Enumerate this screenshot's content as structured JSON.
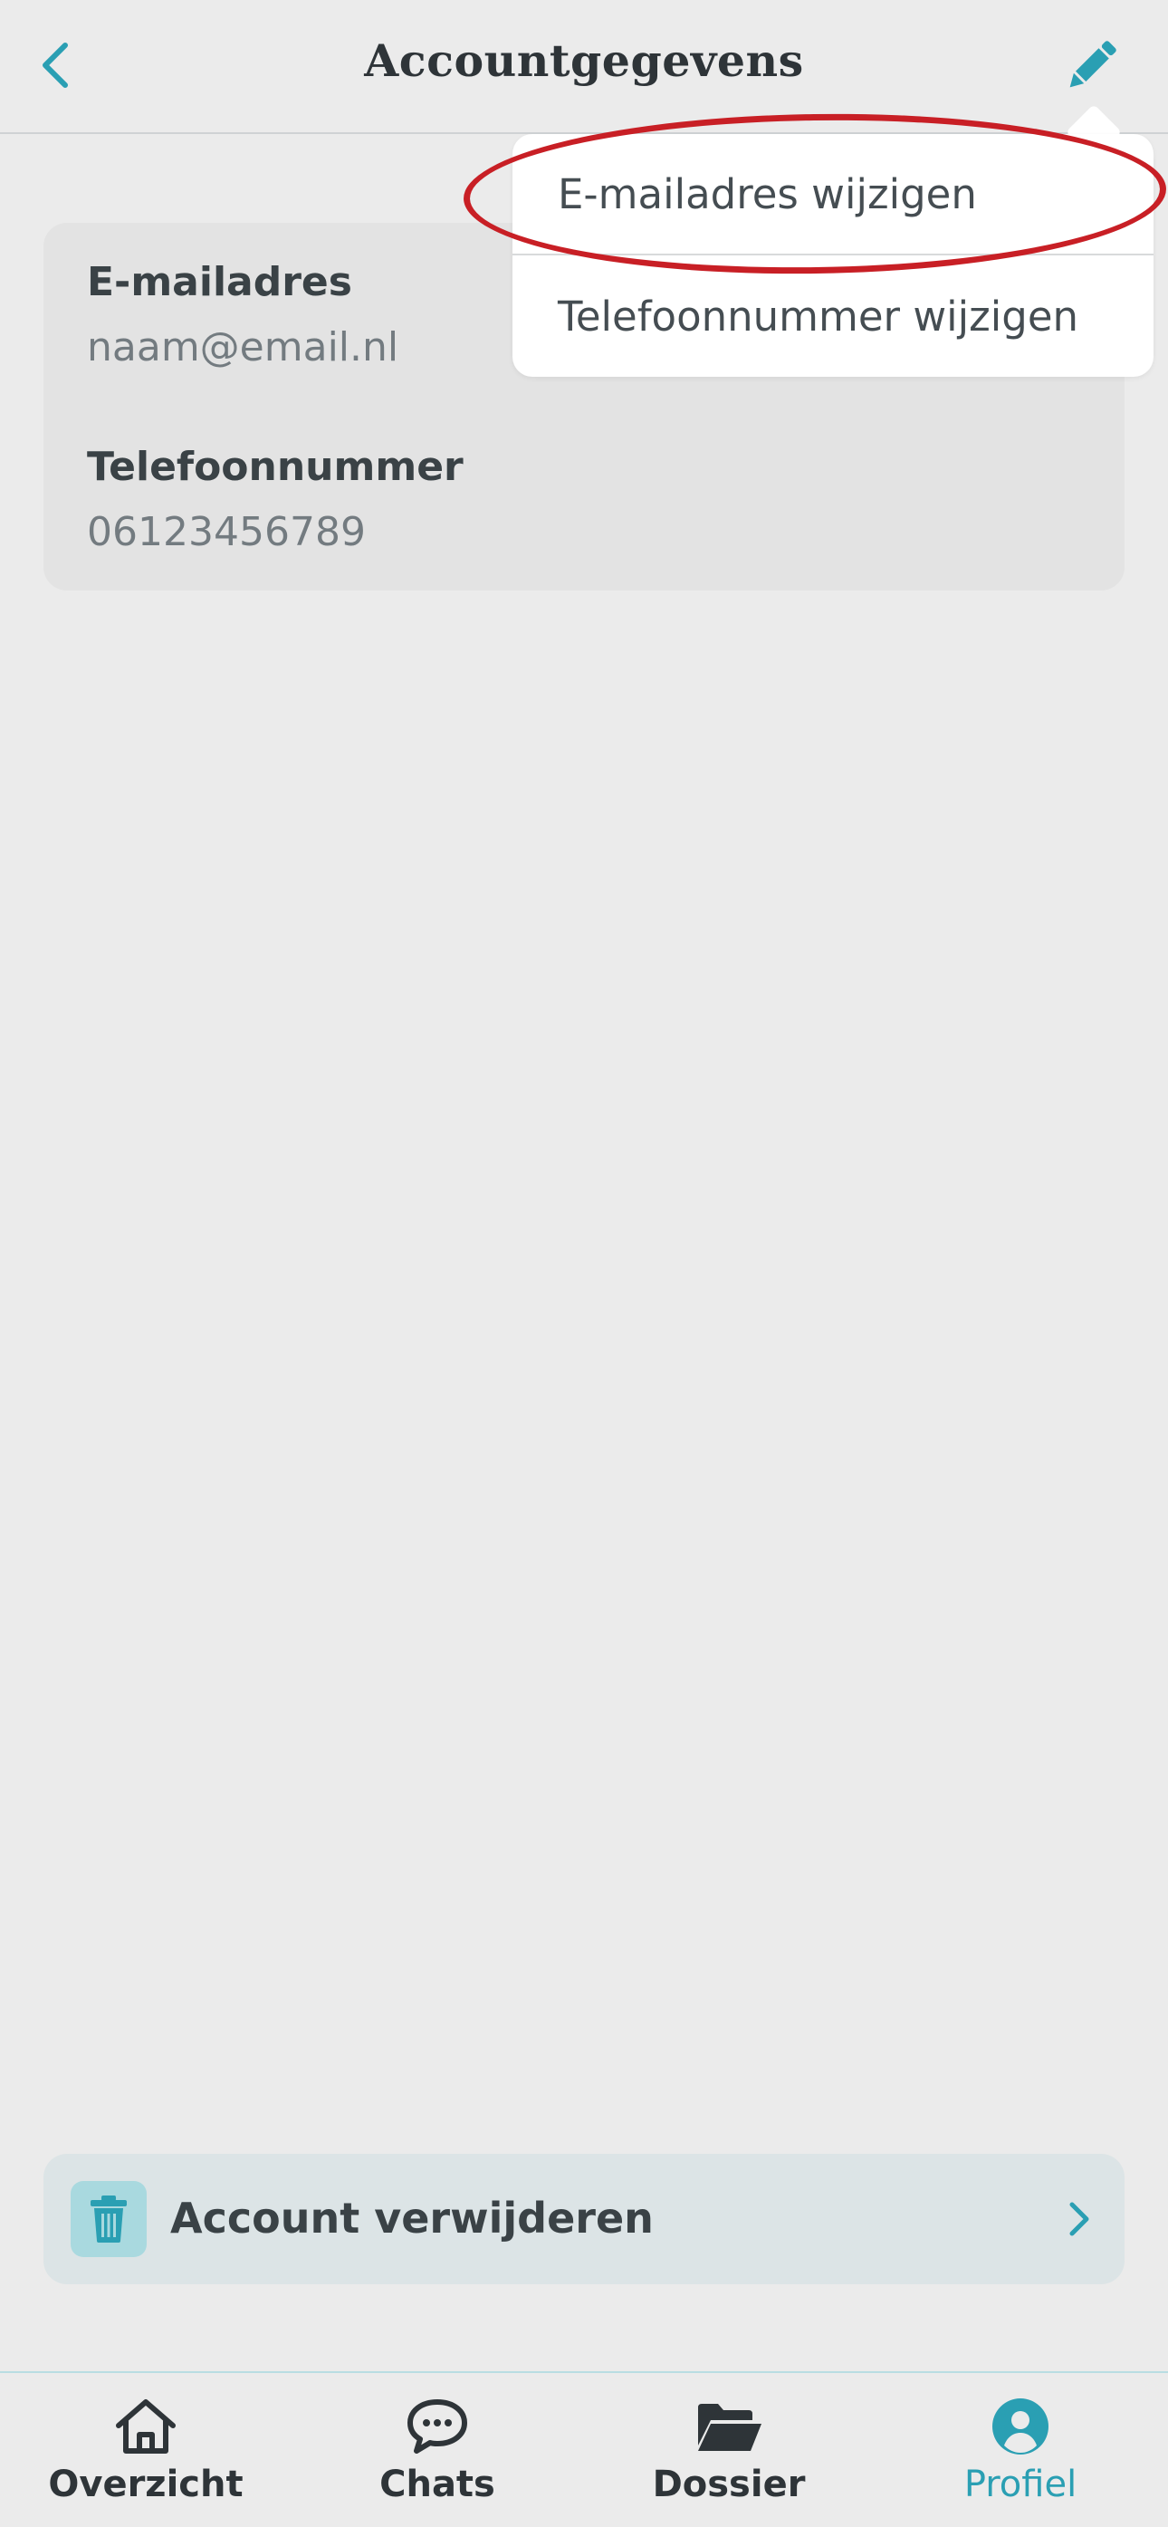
{
  "header": {
    "title": "Accountgegevens"
  },
  "account": {
    "email_label": "E-mailadres",
    "email_value": "naam@email.nl",
    "phone_label": "Telefoonnummer",
    "phone_value": "06123456789"
  },
  "menu": {
    "items": [
      {
        "label": "E-mailadres wijzigen",
        "highlighted": true
      },
      {
        "label": "Telefoonnummer wijzigen"
      }
    ]
  },
  "delete_account": {
    "label": "Account verwijderen"
  },
  "bottom_nav": {
    "items": [
      {
        "label": "Overzicht",
        "icon": "home-icon"
      },
      {
        "label": "Chats",
        "icon": "chat-icon"
      },
      {
        "label": "Dossier",
        "icon": "folder-icon"
      },
      {
        "label": "Profiel",
        "icon": "profile-icon",
        "active": true
      }
    ]
  },
  "colors": {
    "accent": "#2a9fb3",
    "background": "#ebebeb",
    "card": "#e3e3e3",
    "highlight": "#c81f25",
    "delete_row": "#dce4e6"
  }
}
